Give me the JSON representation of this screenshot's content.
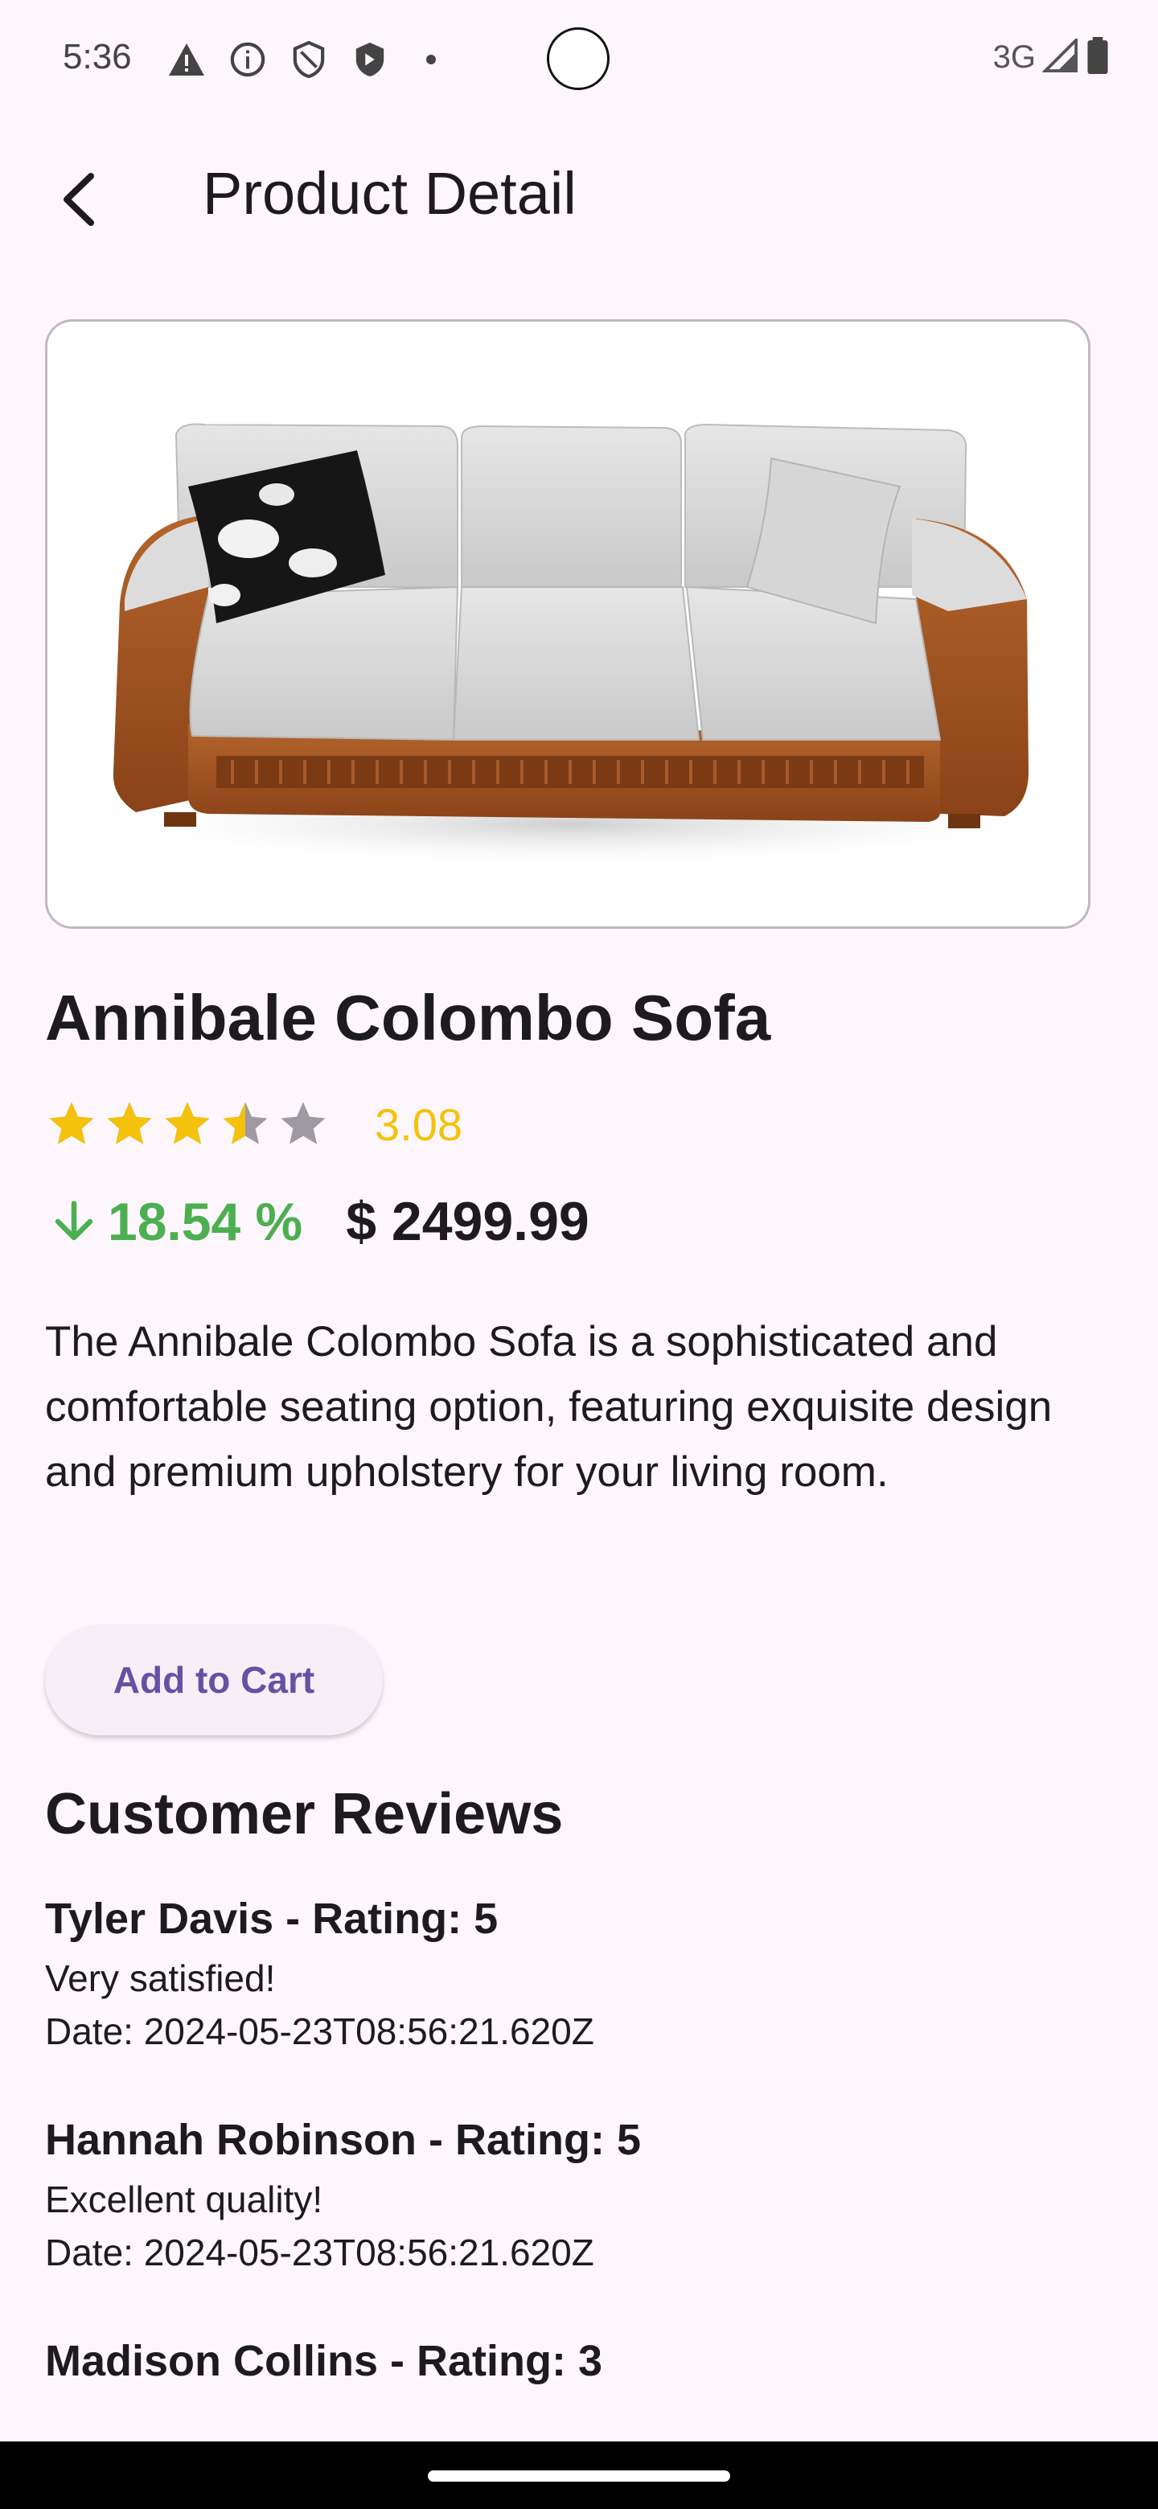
{
  "status_bar": {
    "time": "5:36",
    "network": "3G",
    "icons": [
      "warning-icon",
      "info-icon",
      "shield-outline-icon",
      "shield-filled-icon",
      "dot-icon",
      "signal-icon",
      "battery-icon"
    ]
  },
  "app_bar": {
    "title": "Product Detail",
    "back_icon": "back-arrow-icon"
  },
  "product": {
    "name": "Annibale Colombo Sofa",
    "rating": "3.08",
    "rating_value": 3.08,
    "max_rating": 5,
    "discount": "18.54 %",
    "price": "$ 2499.99",
    "description": "The Annibale Colombo Sofa is a sophisticated and comfortable seating option, featuring exquisite design and premium upholstery for your living room.",
    "image": "sofa-image"
  },
  "actions": {
    "add_to_cart": "Add to Cart"
  },
  "reviews": {
    "title": "Customer Reviews",
    "items": [
      {
        "header": "Tyler Davis - Rating: 5",
        "comment": "Very satisfied!",
        "date": "Date: 2024-05-23T08:56:21.620Z"
      },
      {
        "header": "Hannah Robinson - Rating: 5",
        "comment": "Excellent quality!",
        "date": "Date: 2024-05-23T08:56:21.620Z"
      },
      {
        "header": "Madison Collins - Rating: 3"
      }
    ]
  },
  "colors": {
    "background": "#fdf7fd",
    "star": "#f4c20d",
    "star_empty": "#9e9aa2",
    "discount": "#4caf50",
    "button_text": "#6750a4"
  }
}
